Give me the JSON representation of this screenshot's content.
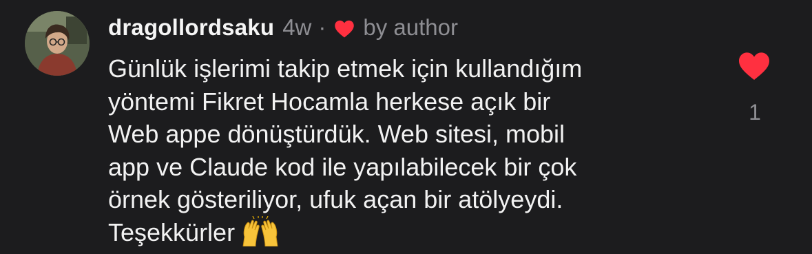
{
  "comment": {
    "username": "dragollordsaku",
    "time_ago": "4w",
    "separator": "·",
    "liked_by_author_label": "by author",
    "text": "Günlük işlerimi takip etmek için kullandığım\nyöntemi Fikret Hocamla herkese açık bir\nWeb appe dönüştürdük. Web sitesi, mobil\napp ve Claude kod ile yapılabilecek bir çok\nörnek gösteriliyor, ufuk açan bir atölyeydi.\nTeşekkürler",
    "emoji": "raising-hands-emoji",
    "like_count": "1"
  },
  "icons": {
    "author_heart": "heart-icon",
    "like_heart": "heart-icon"
  },
  "colors": {
    "background": "#1c1c1e",
    "heart_red": "#ff3040",
    "secondary_text": "#8e8e93",
    "primary_text": "#f2f2f2"
  }
}
